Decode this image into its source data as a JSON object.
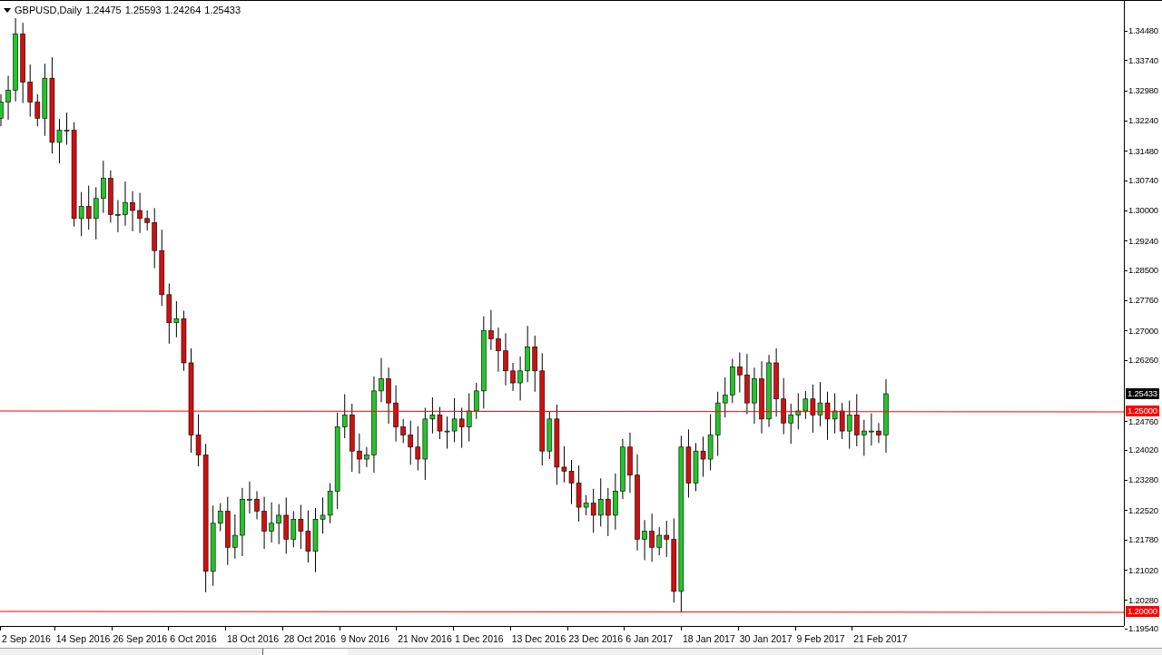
{
  "header": {
    "symbol": "GBPUSD,Daily",
    "ohlc": [
      "1.24475",
      "1.25593",
      "1.24264",
      "1.25433"
    ]
  },
  "price_axis": {
    "ticks": [
      "1.34480",
      "1.33740",
      "1.32980",
      "1.32240",
      "1.31480",
      "1.30740",
      "1.30000",
      "1.29240",
      "1.28500",
      "1.27760",
      "1.27000",
      "1.26260",
      "1.24760",
      "1.24020",
      "1.23280",
      "1.22520",
      "1.21780",
      "1.21020",
      "1.20280",
      "1.19540"
    ]
  },
  "current_price": {
    "label": "1.25433"
  },
  "levels": [
    {
      "label": "1.25000"
    },
    {
      "label": "1.20000"
    }
  ],
  "time_axis": {
    "labels": [
      "2 Sep 2016",
      "14 Sep 2016",
      "26 Sep 2016",
      "6 Oct 2016",
      "18 Oct 2016",
      "28 Oct 2016",
      "9 Nov 2016",
      "21 Nov 2016",
      "1 Dec 2016",
      "13 Dec 2016",
      "23 Dec 2016",
      "6 Jan 2017",
      "18 Jan 2017",
      "30 Jan 2017",
      "9 Feb 2017",
      "21 Feb 2017"
    ]
  }
}
